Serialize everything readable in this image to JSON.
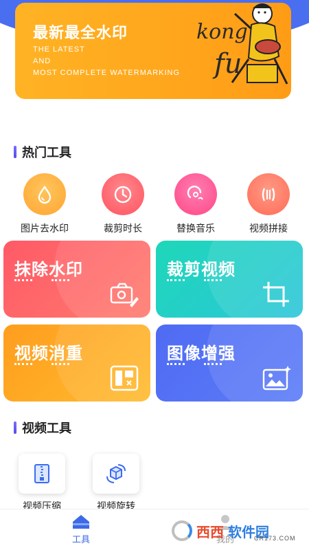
{
  "banner": {
    "title": "最新最全水印",
    "sub_line1": "THE LATEST",
    "sub_line2": "AND",
    "sub_line3": "MOST COMPLETE WATERMARKING",
    "art_text": "kong fu"
  },
  "hot_tools": {
    "title": "热门工具",
    "items": [
      {
        "label": "图片去水印",
        "icon": "drop-icon",
        "color": "#ffa938"
      },
      {
        "label": "裁剪时长",
        "icon": "clock-icon",
        "color": "#ff5d6a"
      },
      {
        "label": "替换音乐",
        "icon": "music-icon",
        "color": "#ff4f8e"
      },
      {
        "label": "视频拼接",
        "icon": "merge-icon",
        "color": "#ff6c5a"
      }
    ]
  },
  "cards": [
    {
      "title": "抹除水印",
      "icon": "camera-erase-icon"
    },
    {
      "title": "裁剪视频",
      "icon": "crop-icon"
    },
    {
      "title": "视频消重",
      "icon": "dedupe-icon"
    },
    {
      "title": "图像增强",
      "icon": "image-enhance-icon"
    }
  ],
  "video_tools": {
    "title": "视频工具",
    "items": [
      {
        "label": "视频压缩",
        "icon": "compress-icon"
      },
      {
        "label": "视频旋转",
        "icon": "rotate-icon"
      }
    ]
  },
  "tabbar": {
    "tab1": "工具",
    "tab2": "我的"
  },
  "watermark": {
    "brand1": "西西",
    "brand2": "软件园",
    "site": "CR173.COM"
  },
  "colors": {
    "accent": "#4a6ef0",
    "tab_active": "#3d6ae6"
  }
}
